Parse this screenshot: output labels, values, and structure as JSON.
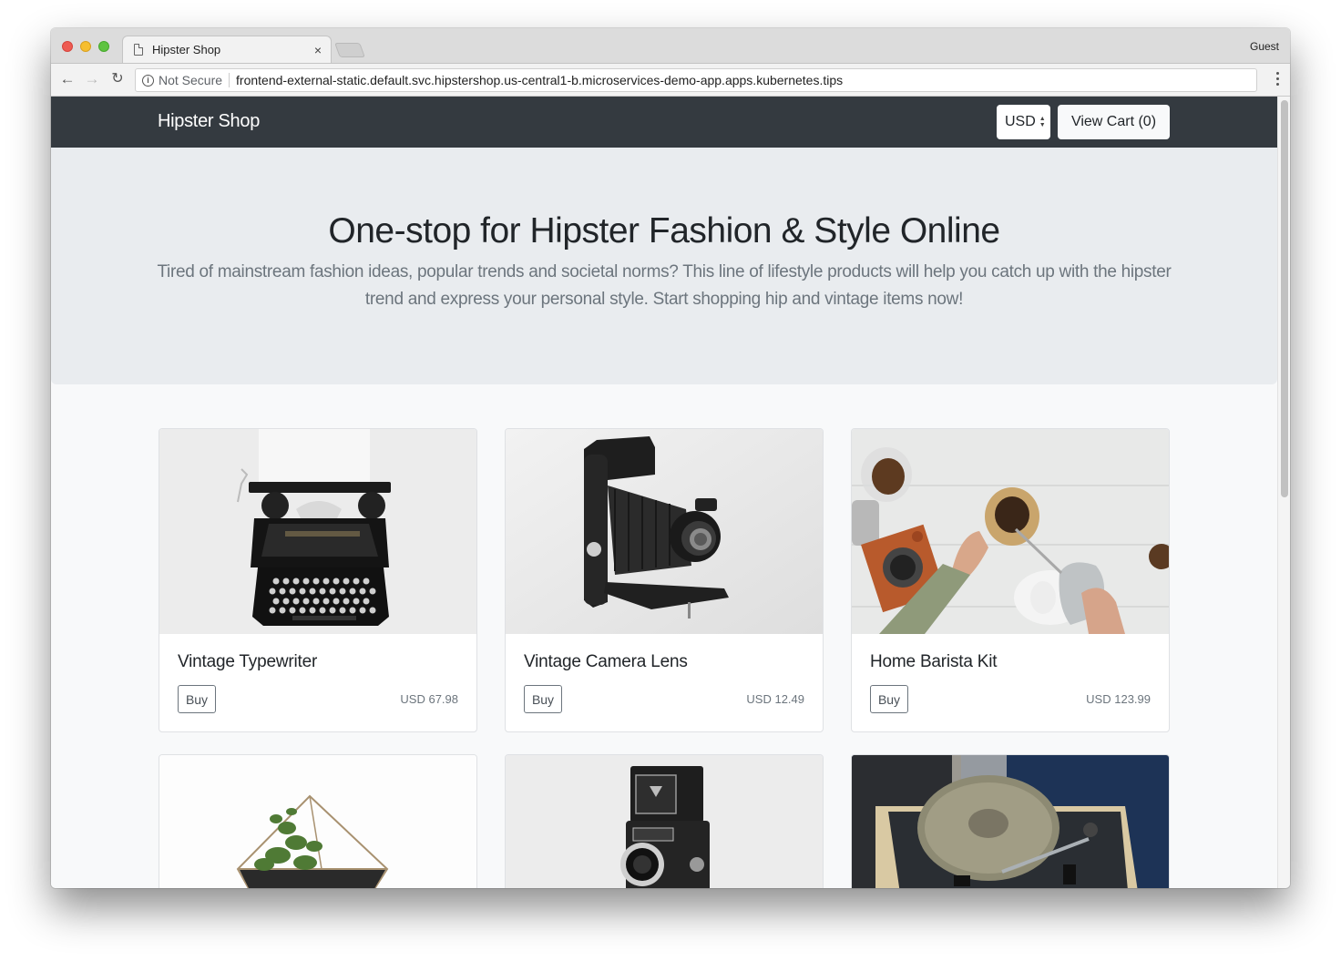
{
  "browser": {
    "tab_title": "Hipster Shop",
    "tab_close": "×",
    "profile": "Guest",
    "security_label": "Not Secure",
    "url": "frontend-external-static.default.svc.hipstershop.us-central1-b.microservices-demo-app.apps.kubernetes.tips",
    "icons": {
      "back": "←",
      "forward": "→",
      "reload": "↻",
      "info": "i"
    }
  },
  "navbar": {
    "brand": "Hipster Shop",
    "currency": "USD",
    "view_cart_label": "View Cart (0)"
  },
  "hero": {
    "title": "One-stop for Hipster Fashion & Style Online",
    "lead": "Tired of mainstream fashion ideas, popular trends and societal norms? This line of lifestyle products will help you catch up with the hipster trend and express your personal style. Start shopping hip and vintage items now!"
  },
  "products": [
    {
      "name": "Vintage Typewriter",
      "buy_label": "Buy",
      "price": "USD 67.98",
      "image": "typewriter"
    },
    {
      "name": "Vintage Camera Lens",
      "buy_label": "Buy",
      "price": "USD 12.49",
      "image": "folding-camera"
    },
    {
      "name": "Home Barista Kit",
      "buy_label": "Buy",
      "price": "USD 123.99",
      "image": "coffee-kit"
    },
    {
      "name": "",
      "image": "terrarium"
    },
    {
      "name": "",
      "image": "twin-lens-camera"
    },
    {
      "name": "",
      "image": "record-player"
    }
  ]
}
